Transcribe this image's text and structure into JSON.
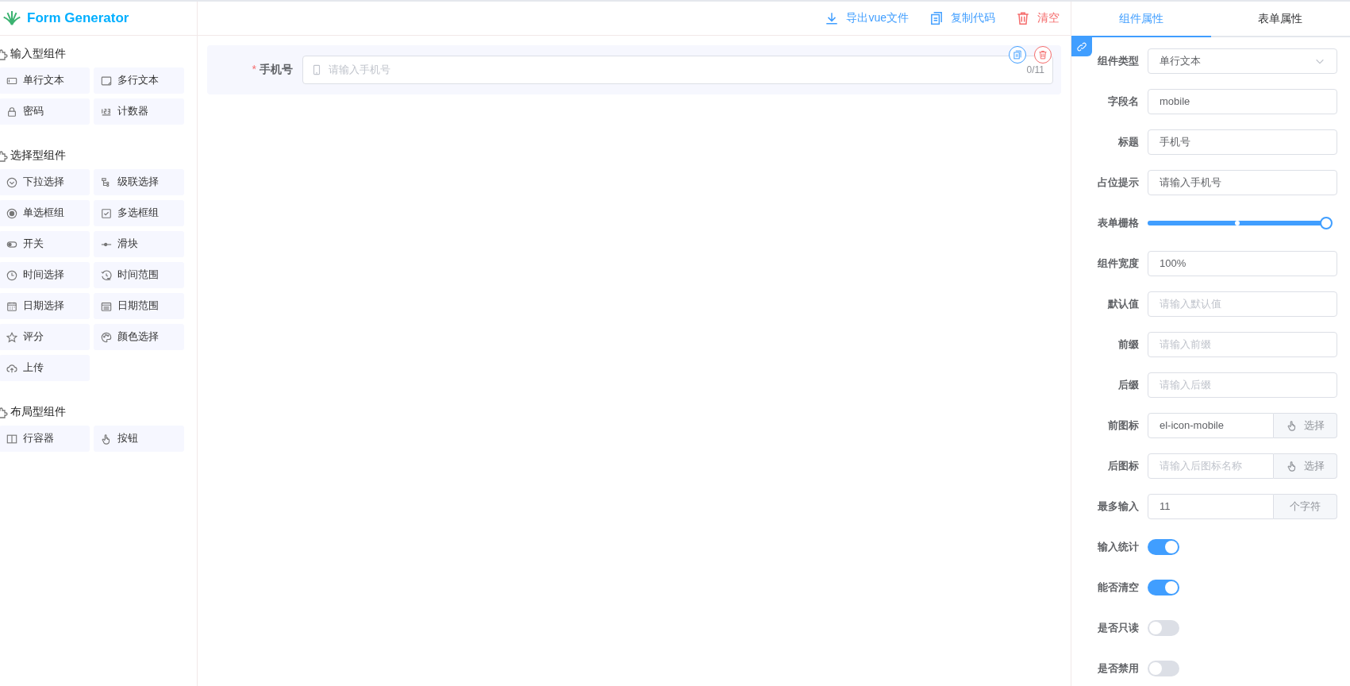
{
  "header": {
    "title": "Form Generator",
    "actions": [
      {
        "label": "导出vue文件",
        "kind": "download"
      },
      {
        "label": "复制代码",
        "kind": "copy"
      },
      {
        "label": "清空",
        "kind": "delete"
      }
    ]
  },
  "component_groups": [
    {
      "title": "输入型组件",
      "items": [
        "单行文本",
        "多行文本",
        "密码",
        "计数器"
      ]
    },
    {
      "title": "选择型组件",
      "items": [
        "下拉选择",
        "级联选择",
        "单选框组",
        "多选框组",
        "开关",
        "滑块",
        "时间选择",
        "时间范围",
        "日期选择",
        "日期范围",
        "评分",
        "颜色选择",
        "上传"
      ]
    },
    {
      "title": "布局型组件",
      "items": [
        "行容器",
        "按钮"
      ]
    }
  ],
  "canvas": {
    "fields": [
      {
        "label": "手机号",
        "required_mark": "*",
        "placeholder": "请输入手机号",
        "counter": "0/11",
        "selected": true
      }
    ]
  },
  "panel": {
    "tabs": [
      {
        "label": "组件属性",
        "selected": true
      },
      {
        "label": "表单属性",
        "selected": false
      }
    ],
    "rows": [
      {
        "kind": "select",
        "label": "组件类型",
        "value": "单行文本"
      },
      {
        "kind": "input",
        "label": "字段名",
        "value": "mobile"
      },
      {
        "kind": "input",
        "label": "标题",
        "value": "手机号"
      },
      {
        "kind": "input",
        "label": "占位提示",
        "value": "请输入手机号"
      },
      {
        "kind": "slider",
        "label": "表单栅格",
        "level": 1
      },
      {
        "kind": "input",
        "label": "组件宽度",
        "value": "100%"
      },
      {
        "kind": "input",
        "label": "默认值",
        "placeholder": "请输入默认值"
      },
      {
        "kind": "input",
        "label": "前缀",
        "placeholder": "请输入前缀"
      },
      {
        "kind": "input",
        "label": "后缀",
        "placeholder": "请输入后缀"
      },
      {
        "kind": "pick",
        "label": "前图标",
        "value": "el-icon-mobile",
        "button": "选择"
      },
      {
        "kind": "pick",
        "label": "后图标",
        "placeholder": "请输入后图标名称",
        "button": "选择"
      },
      {
        "kind": "append",
        "label": "最多输入",
        "value": "11",
        "append": "个字符"
      },
      {
        "kind": "switch",
        "label": "输入统计",
        "on": true
      },
      {
        "kind": "switch",
        "label": "能否清空",
        "on": true
      },
      {
        "kind": "switch",
        "label": "是否只读",
        "on": false
      },
      {
        "kind": "switch",
        "label": "是否禁用",
        "on": false
      }
    ]
  }
}
